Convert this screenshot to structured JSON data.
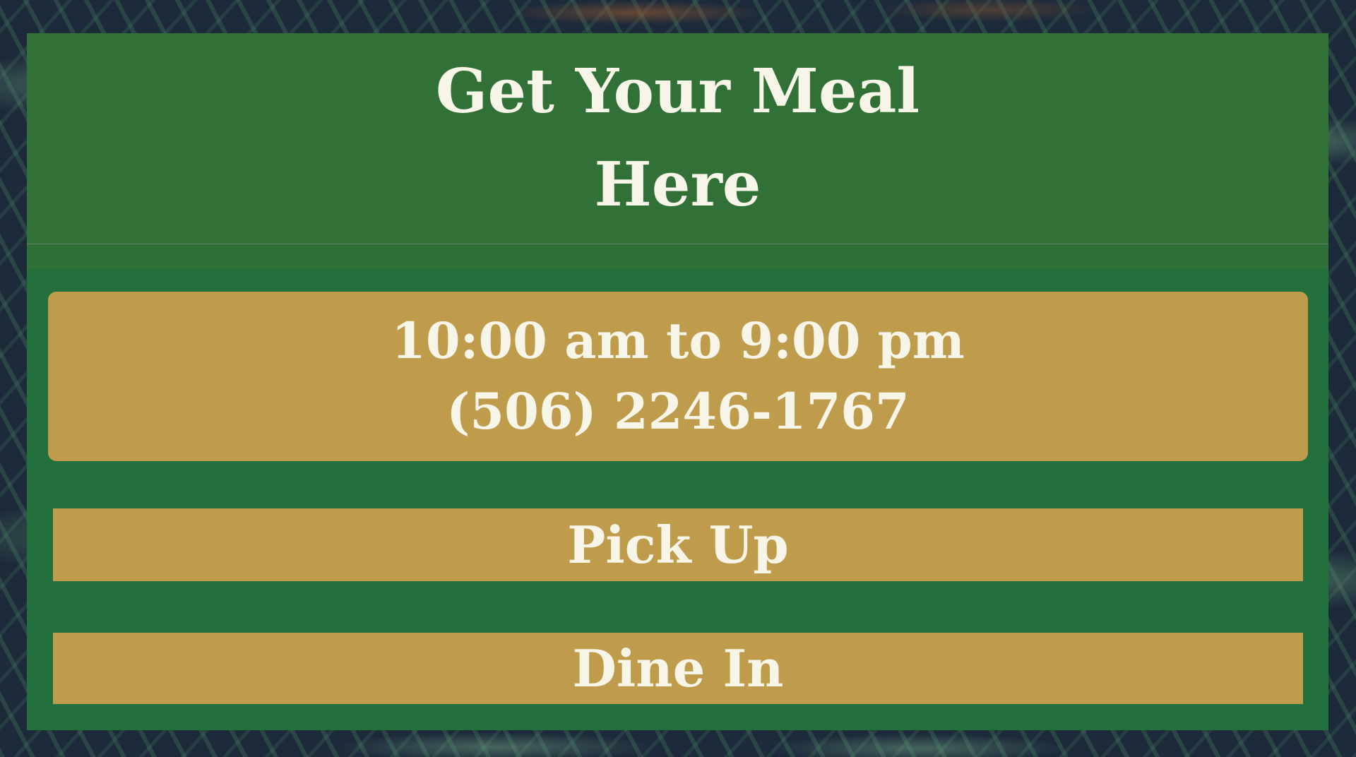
{
  "header": {
    "title_line1": "Get Your Meal",
    "title_line2": "Here"
  },
  "info": {
    "hours": "10:00 am to 9:00 pm",
    "phone": "(506) 2246-1767"
  },
  "buttons": {
    "pickup_label": "Pick Up",
    "dinein_label": "Dine In"
  },
  "colors": {
    "header_bg": "#317037",
    "panel_bg": "#23703d",
    "accent_gold": "#bf9c4c",
    "text_cream": "#f7f5e8"
  }
}
